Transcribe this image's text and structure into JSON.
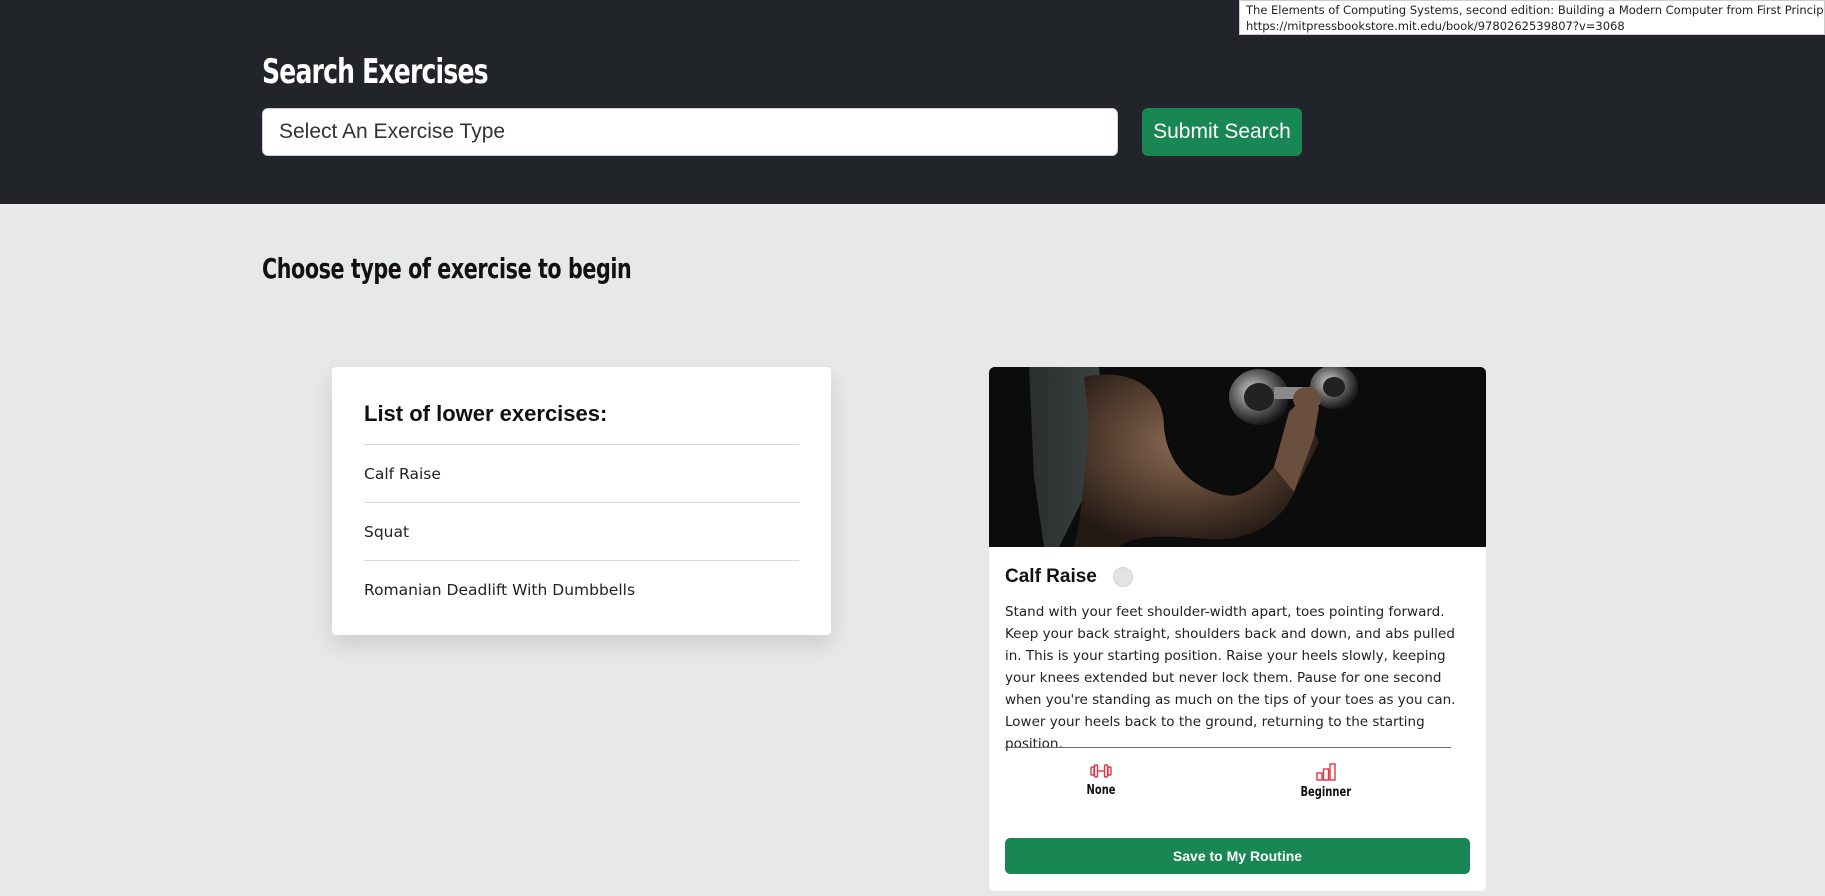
{
  "header": {
    "title": "Search Exercises",
    "search_placeholder": "Select An Exercise Type",
    "submit_label": "Submit Search"
  },
  "tooltip": {
    "line1": "The Elements of Computing Systems, second edition: Building a Modern Computer from First Principles | mitp",
    "line2": "https://mitpressbookstore.mit.edu/book/9780262539807?v=3068"
  },
  "main": {
    "heading": "Choose type of exercise to begin"
  },
  "exercise_list": {
    "title": "List of lower exercises:",
    "items": [
      "Calf Raise",
      "Squat",
      "Romanian Deadlift With Dumbbells"
    ]
  },
  "detail": {
    "name": "Calf Raise",
    "description": "Stand with your feet shoulder-width apart, toes pointing forward. Keep your back straight, shoulders back and down, and abs pulled in. This is your starting position. Raise your heels slowly, keeping your knees extended but never lock them. Pause for one second when you're standing as much on the tips of your toes as you can. Lower your heels back to the ground, returning to the starting position.",
    "equipment": "None",
    "difficulty": "Beginner",
    "save_label": "Save to My Routine"
  },
  "colors": {
    "header_bg": "#212529",
    "page_bg": "#e7e9e8",
    "primary_green": "#198754",
    "icon_red": "#dc3545"
  },
  "icons": {
    "equipment": "dumbbell-icon",
    "difficulty": "bar-chart-icon"
  }
}
